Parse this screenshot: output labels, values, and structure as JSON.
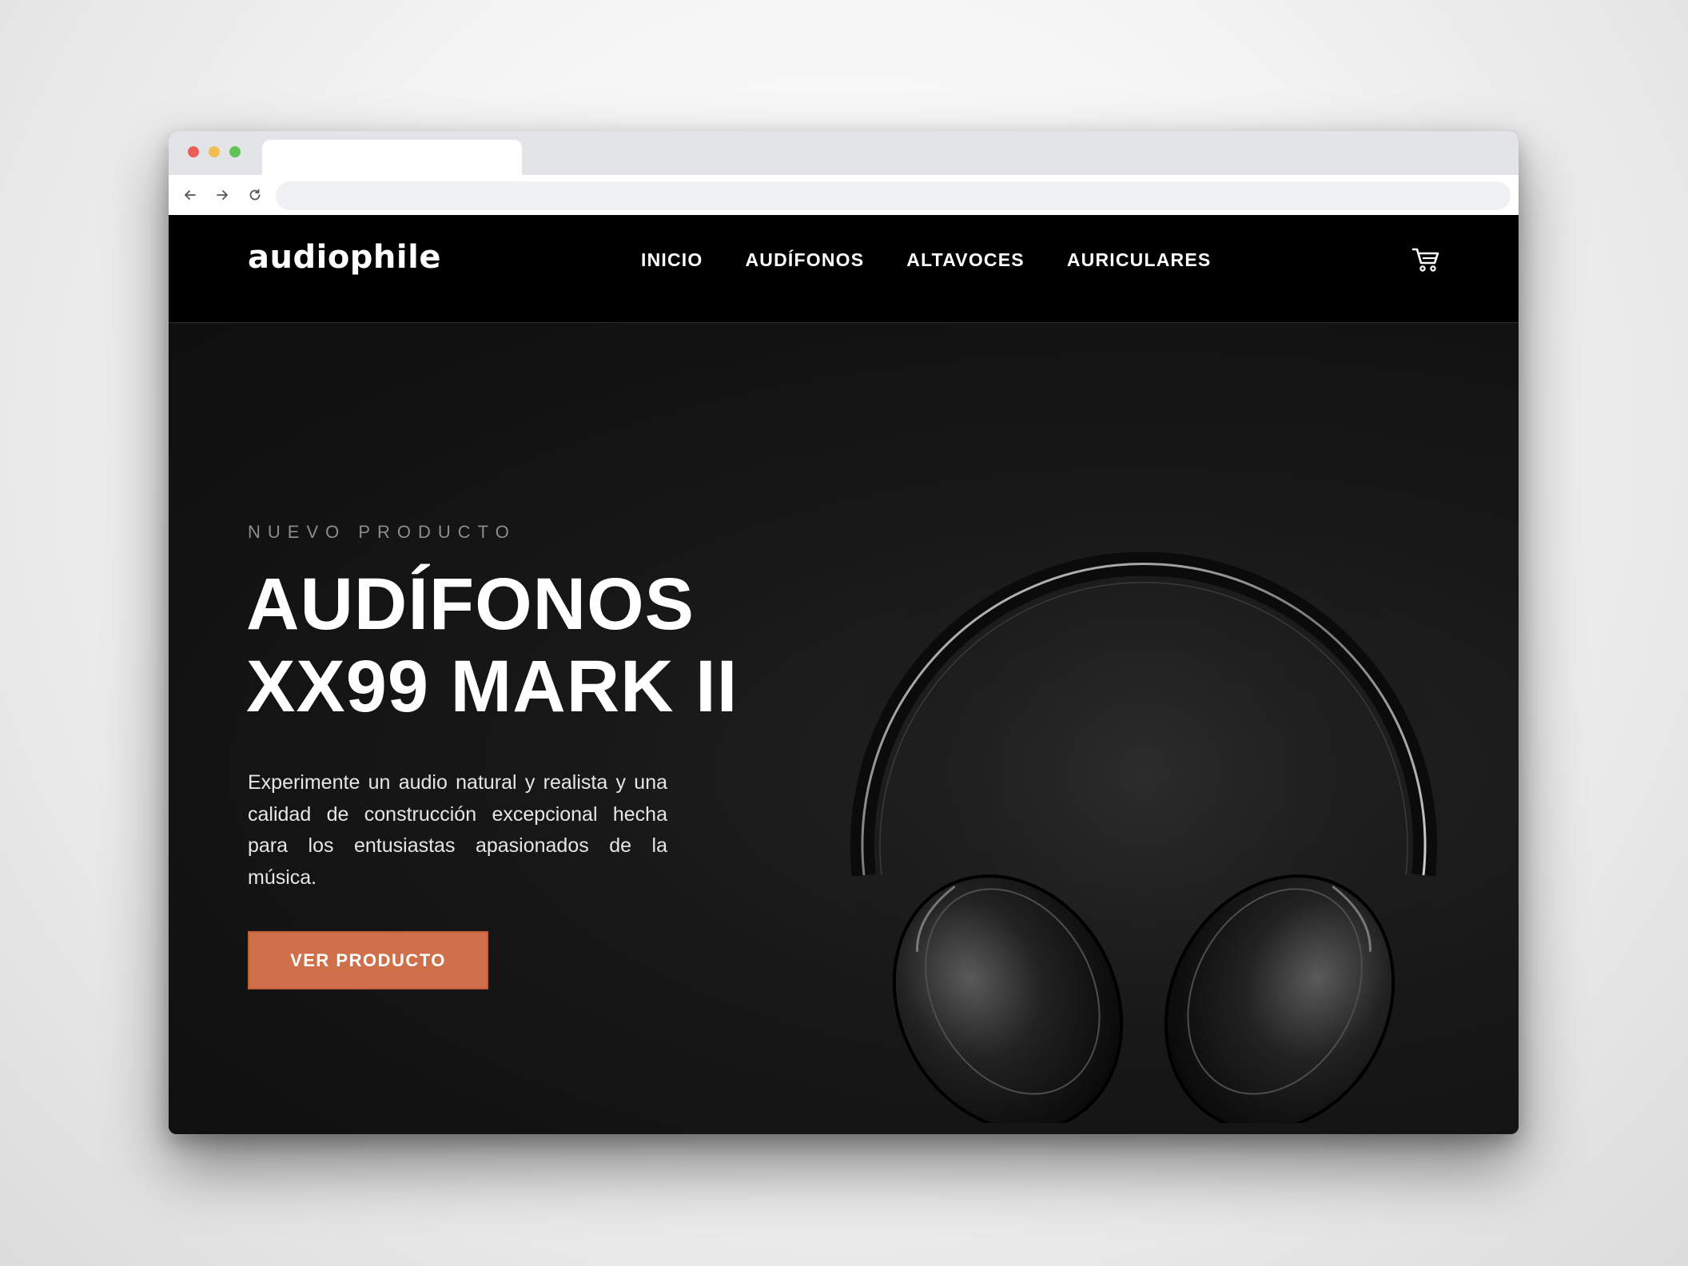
{
  "browser": {
    "dot_colors": [
      "#ec5f57",
      "#f4bd4f",
      "#5fc454"
    ],
    "icons": [
      "back-arrow-icon",
      "forward-arrow-icon",
      "reload-icon"
    ]
  },
  "header": {
    "logo": "audiophile",
    "nav": [
      "INICIO",
      "AUDÍFONOS",
      "ALTAVOCES",
      "AURICULARES"
    ],
    "cart_icon": "cart-icon"
  },
  "hero": {
    "overline": "NUEVO PRODUCTO",
    "title_line1": "AUDÍFONOS",
    "title_line2": "XX99 MARK II",
    "description": "Experimente un audio natural y realista y una calidad de construcción excepcional hecha para los entusiastas apasionados de la música.",
    "cta": "VER PRODUCTO",
    "image_icon": "headphones-image"
  },
  "colors": {
    "accent": "#d87d4a",
    "header_bg": "#000000",
    "hero_bg": "#141414"
  }
}
